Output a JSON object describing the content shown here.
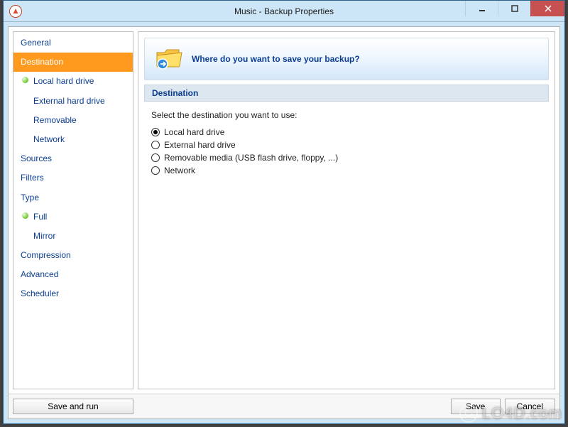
{
  "window": {
    "title": "Music - Backup Properties"
  },
  "sidebar": {
    "items": [
      {
        "label": "General",
        "level": 0
      },
      {
        "label": "Destination",
        "level": 0,
        "selected": true
      },
      {
        "label": "Local hard drive",
        "level": 1,
        "dot": true
      },
      {
        "label": "External hard drive",
        "level": 1
      },
      {
        "label": "Removable",
        "level": 1
      },
      {
        "label": "Network",
        "level": 1
      },
      {
        "label": "Sources",
        "level": 0
      },
      {
        "label": "Filters",
        "level": 0
      },
      {
        "label": "Type",
        "level": 0
      },
      {
        "label": "Full",
        "level": 1,
        "dot": true
      },
      {
        "label": "Mirror",
        "level": 1
      },
      {
        "label": "Compression",
        "level": 0
      },
      {
        "label": "Advanced",
        "level": 0
      },
      {
        "label": "Scheduler",
        "level": 0
      }
    ]
  },
  "content": {
    "banner_question": "Where do you want to save your backup?",
    "section_title": "Destination",
    "prompt": "Select the destination you want to use:",
    "options": [
      {
        "label": "Local hard drive",
        "checked": true
      },
      {
        "label": "External hard drive",
        "checked": false
      },
      {
        "label": "Removable media (USB flash drive, floppy, ...)",
        "checked": false
      },
      {
        "label": "Network",
        "checked": false
      }
    ]
  },
  "footer": {
    "save_and_run": "Save and run",
    "save": "Save",
    "cancel": "Cancel"
  },
  "watermark": "LO4D.com"
}
